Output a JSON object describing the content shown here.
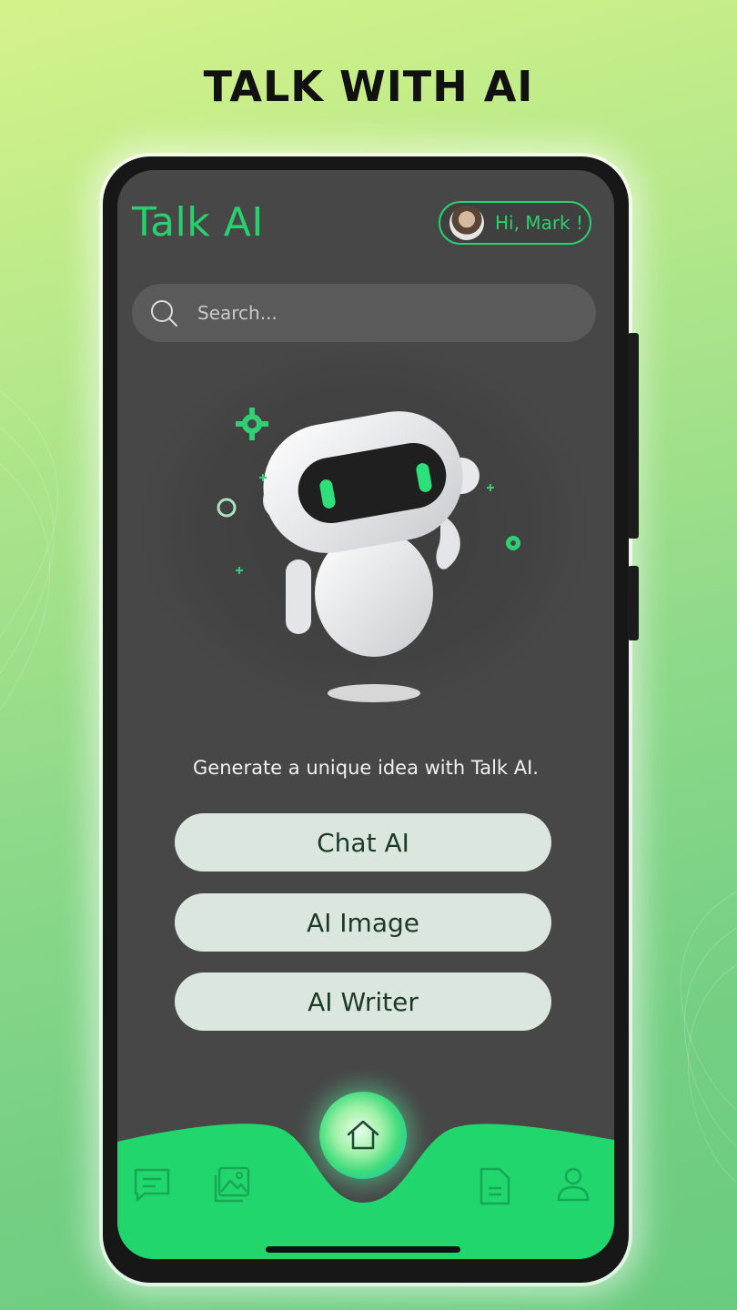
{
  "headline": "TALK WITH AI",
  "app": {
    "brand": "Talk AI",
    "greeting": "Hi, Mark !"
  },
  "search": {
    "placeholder": "Search..."
  },
  "tagline": "Generate a unique idea with Talk AI.",
  "actions": [
    {
      "label": "Chat AI"
    },
    {
      "label": "AI Image"
    },
    {
      "label": "AI Writer"
    }
  ],
  "nav": {
    "items": [
      {
        "icon": "chat-icon"
      },
      {
        "icon": "image-icon"
      },
      {
        "icon": "home-icon",
        "active": true
      },
      {
        "icon": "document-icon"
      },
      {
        "icon": "user-icon"
      }
    ]
  },
  "colors": {
    "accent": "#27d26e",
    "screen_bg": "#474747",
    "button_bg": "#dbe7de",
    "button_text": "#1c3a26"
  }
}
